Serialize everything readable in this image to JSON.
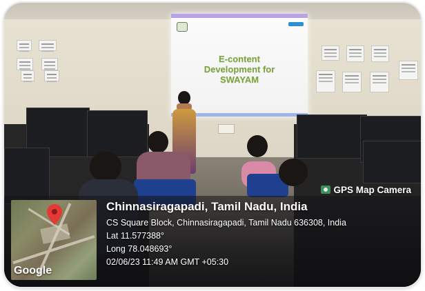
{
  "slide": {
    "title_text": "E-content\nDevelopment for\nSWAYAM"
  },
  "gps_badge": {
    "label": "GPS Map Camera",
    "icon": "camera-icon"
  },
  "location": {
    "title": "Chinnasiragapadi, Tamil Nadu, India",
    "address": "CS Square Block, Chinnasiragapadi, Tamil Nadu 636308, India",
    "lat": "Lat 11.577388°",
    "long": "Long 78.048693°",
    "datetime": "02/06/23 11:49 AM GMT +05:30"
  },
  "map": {
    "brand": "Google",
    "pin_icon": "map-pin-icon",
    "pin_color": "#e53935"
  },
  "colors": {
    "slide_title": "#7aa33a",
    "chair_blue": "#1f3f8f",
    "overlay_text": "#ffffff"
  }
}
